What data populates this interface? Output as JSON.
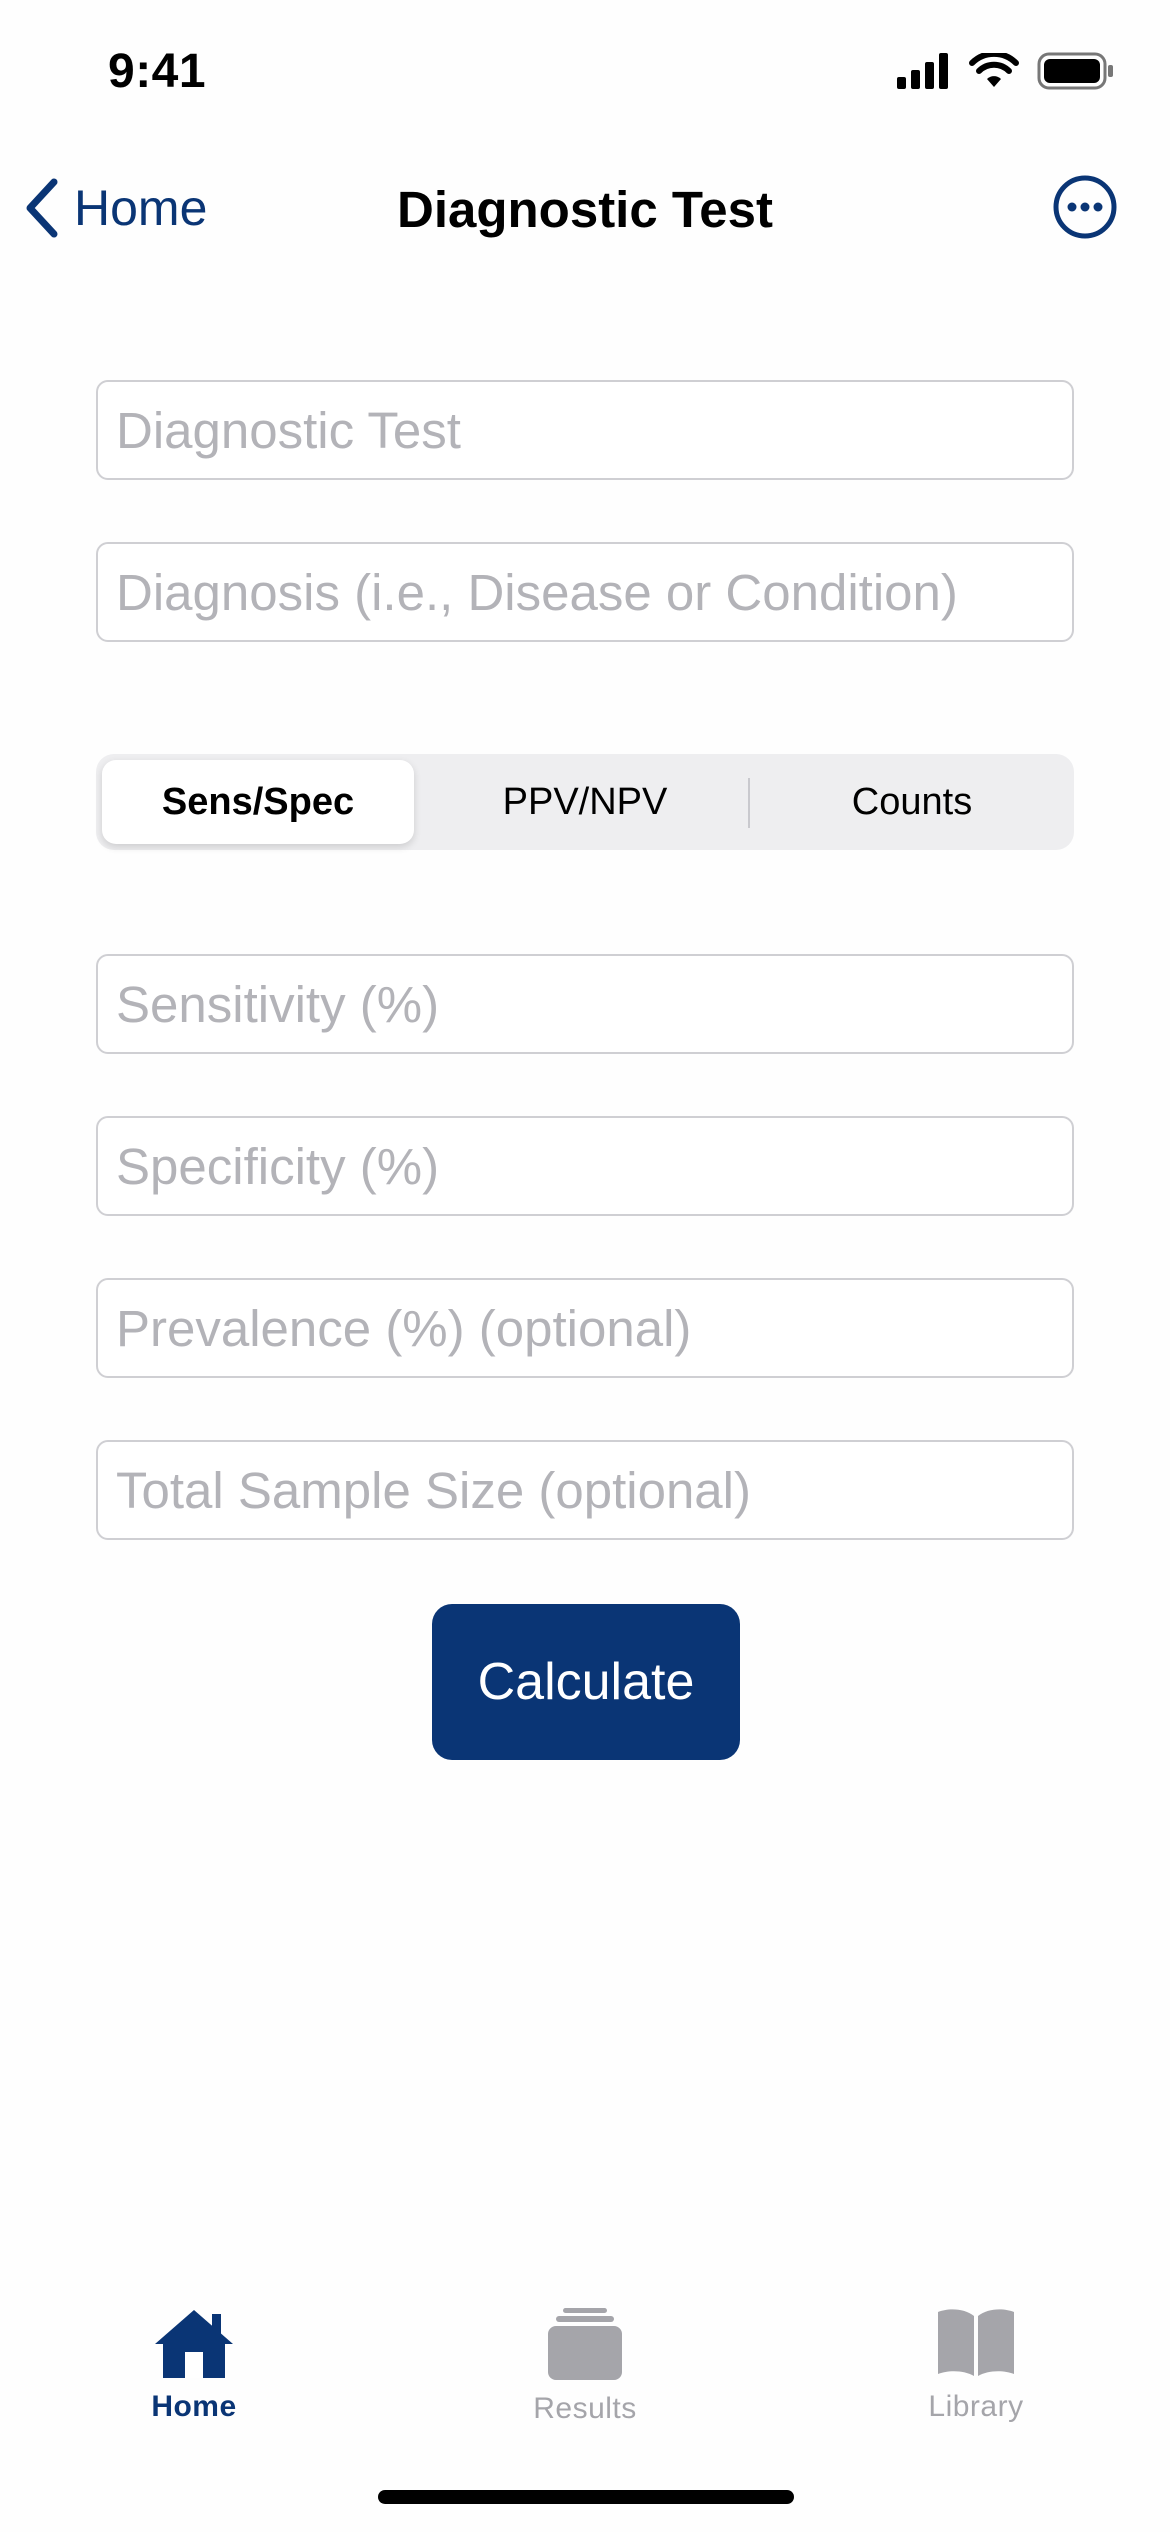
{
  "status": {
    "time": "9:41"
  },
  "nav": {
    "back_label": "Home",
    "title": "Diagnostic Test"
  },
  "inputs": {
    "test_name": {
      "placeholder": "Diagnostic Test",
      "value": ""
    },
    "diagnosis": {
      "placeholder": "Diagnosis (i.e., Disease or Condition)",
      "value": ""
    },
    "sensitivity": {
      "placeholder": "Sensitivity (%)",
      "value": ""
    },
    "specificity": {
      "placeholder": "Specificity (%)",
      "value": ""
    },
    "prevalence": {
      "placeholder": "Prevalence (%) (optional)",
      "value": ""
    },
    "sample_size": {
      "placeholder": "Total Sample Size (optional)",
      "value": ""
    }
  },
  "segments": [
    {
      "label": "Sens/Spec",
      "selected": true
    },
    {
      "label": "PPV/NPV",
      "selected": false
    },
    {
      "label": "Counts",
      "selected": false
    }
  ],
  "actions": {
    "calculate_label": "Calculate"
  },
  "tabbar": {
    "items": [
      {
        "label": "Home",
        "icon": "house-icon",
        "active": true
      },
      {
        "label": "Results",
        "icon": "stack-icon",
        "active": false
      },
      {
        "label": "Library",
        "icon": "book-icon",
        "active": false
      }
    ]
  },
  "colors": {
    "accent": "#0a3575",
    "inactive": "#a5a5aa",
    "placeholder": "#b3b3b8"
  }
}
